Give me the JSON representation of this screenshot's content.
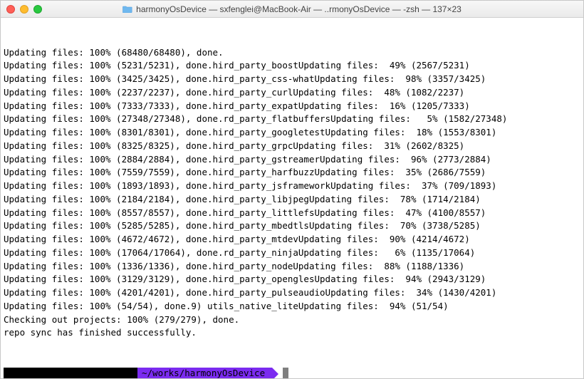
{
  "window": {
    "title_prefix": "harmonyOsDevice — sxfenglei@MacBook-Air — ..rmonyOsDevice — -zsh — 137×23"
  },
  "terminal": {
    "lines": [
      "Updating files: 100% (68480/68480), done.",
      "Updating files: 100% (5231/5231), done.hird_party_boostUpdating files:  49% (2567/5231)",
      "Updating files: 100% (3425/3425), done.hird_party_css-whatUpdating files:  98% (3357/3425)",
      "Updating files: 100% (2237/2237), done.hird_party_curlUpdating files:  48% (1082/2237)",
      "Updating files: 100% (7333/7333), done.hird_party_expatUpdating files:  16% (1205/7333)",
      "Updating files: 100% (27348/27348), done.rd_party_flatbuffersUpdating files:   5% (1582/27348)",
      "Updating files: 100% (8301/8301), done.hird_party_googletestUpdating files:  18% (1553/8301)",
      "Updating files: 100% (8325/8325), done.hird_party_grpcUpdating files:  31% (2602/8325)",
      "Updating files: 100% (2884/2884), done.hird_party_gstreamerUpdating files:  96% (2773/2884)",
      "Updating files: 100% (7559/7559), done.hird_party_harfbuzzUpdating files:  35% (2686/7559)",
      "Updating files: 100% (1893/1893), done.hird_party_jsframeworkUpdating files:  37% (709/1893)",
      "Updating files: 100% (2184/2184), done.hird_party_libjpegUpdating files:  78% (1714/2184)",
      "Updating files: 100% (8557/8557), done.hird_party_littlefsUpdating files:  47% (4100/8557)",
      "Updating files: 100% (5285/5285), done.hird_party_mbedtlsUpdating files:  70% (3738/5285)",
      "Updating files: 100% (4672/4672), done.hird_party_mtdevUpdating files:  90% (4214/4672)",
      "Updating files: 100% (17064/17064), done.rd_party_ninjaUpdating files:   6% (1135/17064)",
      "Updating files: 100% (1336/1336), done.hird_party_nodeUpdating files:  88% (1188/1336)",
      "Updating files: 100% (3129/3129), done.hird_party_openglesUpdating files:  94% (2943/3129)",
      "Updating files: 100% (4201/4201), done.hird_party_pulseaudioUpdating files:  34% (1430/4201)",
      "Updating files: 100% (54/54), done.9) utils_native_liteUpdating files:  94% (51/54)",
      "Checking out projects: 100% (279/279), done.",
      "repo sync has finished successfully."
    ],
    "prompt_cwd": "~/works/harmonyOsDevice"
  },
  "colors": {
    "prompt_seg1_bg": "#000000",
    "prompt_seg2_bg": "#7b2bf0",
    "prompt_seg2_fg": "#000000"
  }
}
